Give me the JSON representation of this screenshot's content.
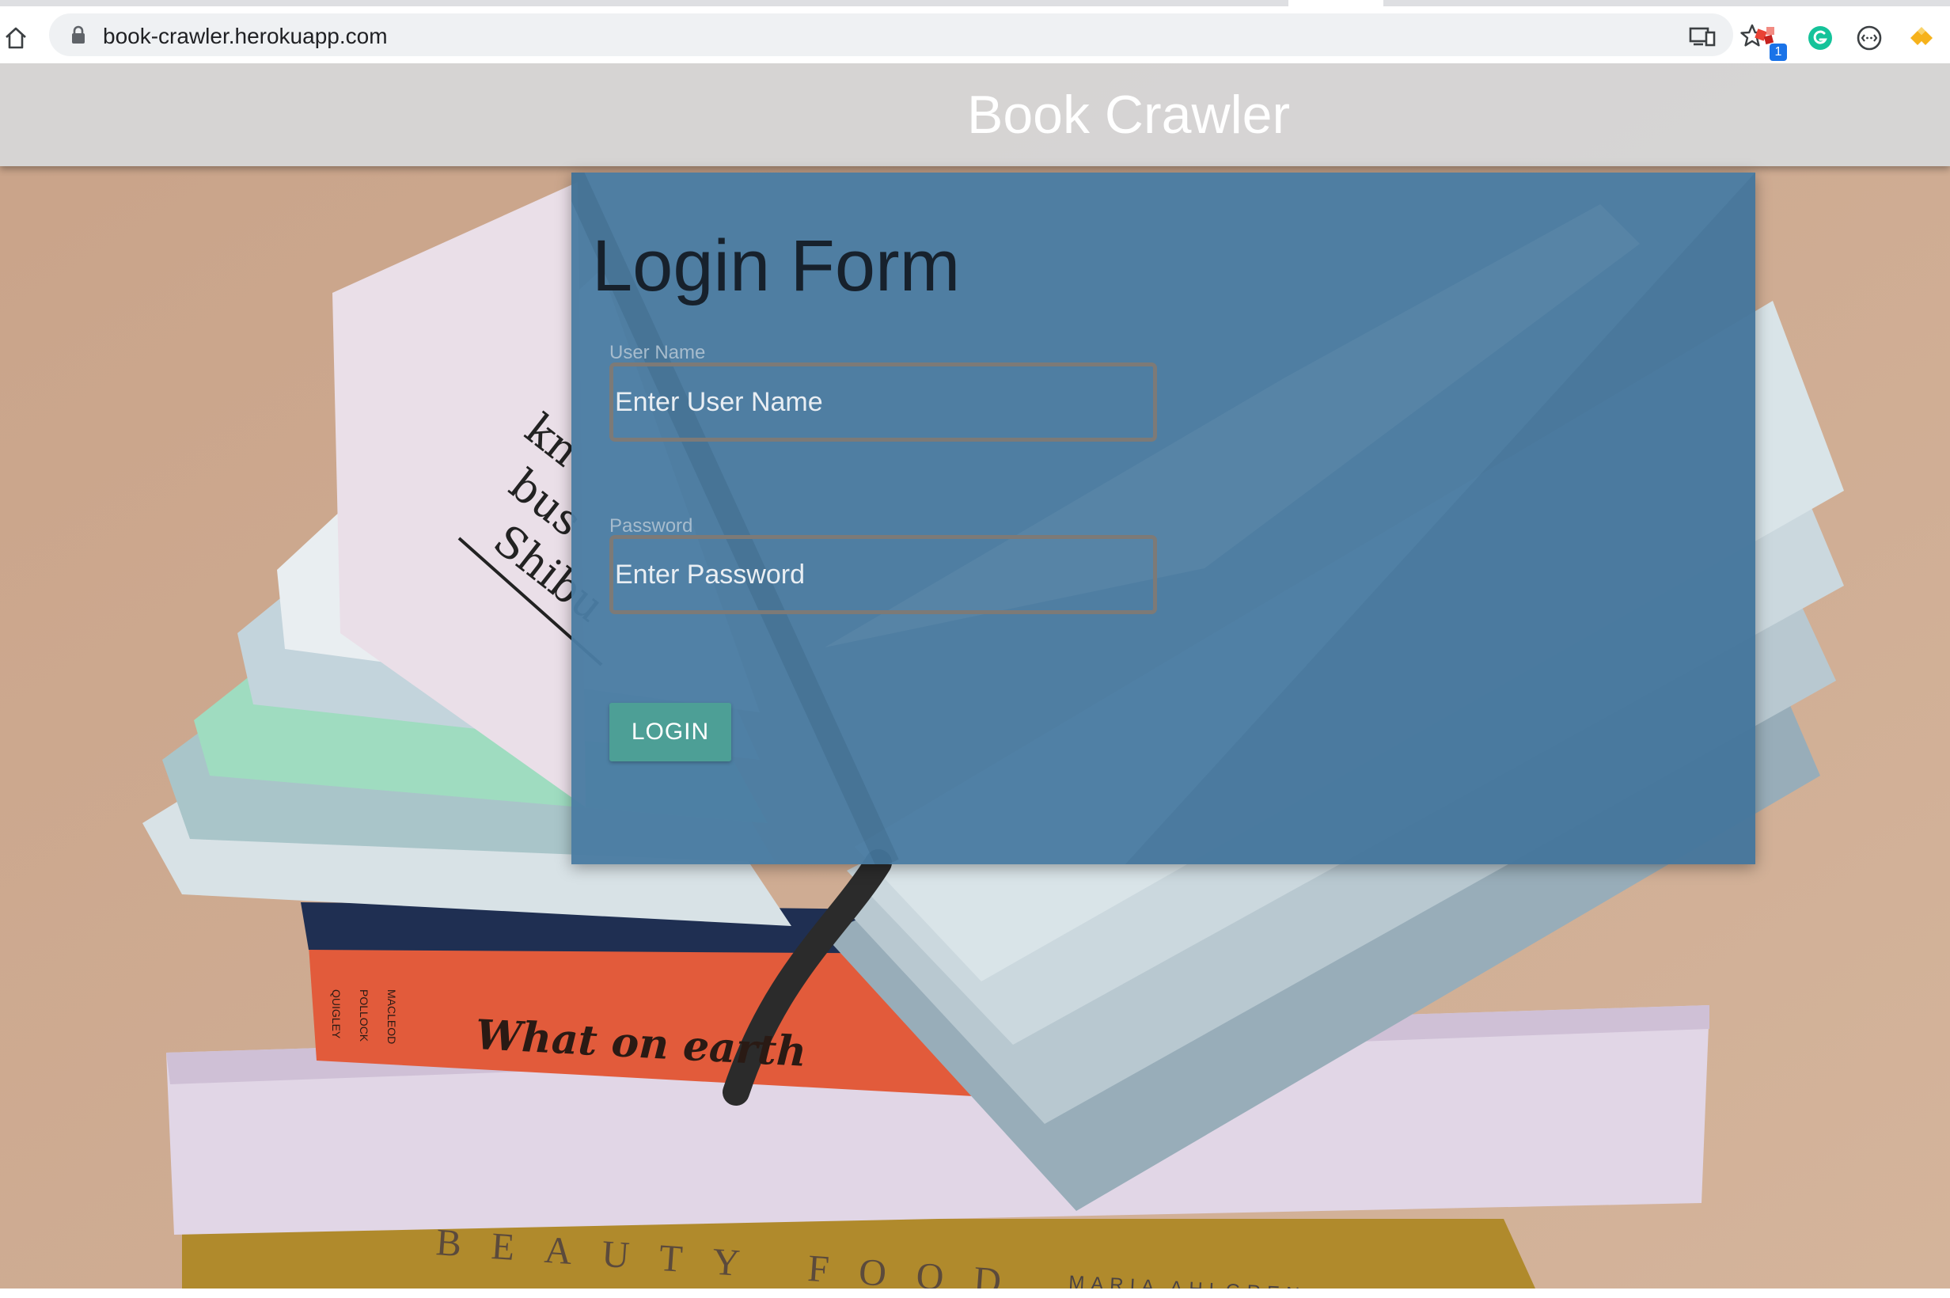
{
  "browser": {
    "url": "book-crawler.herokuapp.com",
    "extension_badge": "1",
    "icons": [
      "home-icon",
      "lock-icon",
      "cast-icon",
      "star-icon",
      "extension-icon",
      "grammarly-icon",
      "code-icon",
      "extension-icon"
    ]
  },
  "header": {
    "title": "Book Crawler"
  },
  "login_form": {
    "heading": "Login Form",
    "username": {
      "label": "User Name",
      "placeholder": "Enter User Name",
      "value": ""
    },
    "password": {
      "label": "Password",
      "placeholder": "Enter Password",
      "value": ""
    },
    "submit_label": "LOGIN"
  },
  "background_text": {
    "book_spine": "What on earth",
    "book_cover": "BEAUTY FOOD",
    "author": "MARIA AHLGREN",
    "spine_names": [
      "QUIGLEY",
      "POLLOCK",
      "MACLEOD"
    ],
    "page_words": [
      "kn",
      "bus",
      "Shibu"
    ]
  },
  "colors": {
    "card": "#4a7ca2",
    "button": "#4d9f96",
    "header": "#d6d6d6",
    "background": "#c9a88e"
  }
}
